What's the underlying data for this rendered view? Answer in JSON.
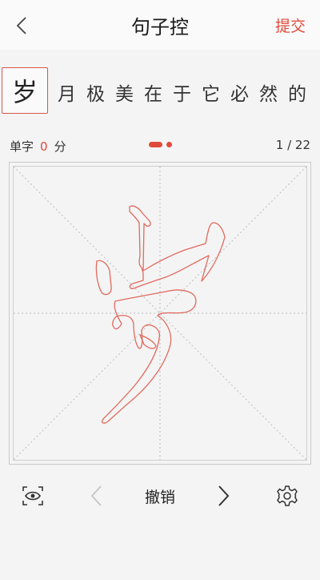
{
  "header": {
    "title": "句子控",
    "submit_label": "提交",
    "back_icon": "chevron-left-icon"
  },
  "sentence": {
    "current_char": "岁",
    "upcoming_chars": [
      "月",
      "极",
      "美",
      "在",
      "于",
      "它",
      "必",
      "然",
      "的"
    ]
  },
  "status": {
    "score_label": "单字",
    "score_value": "0",
    "score_unit": "分",
    "page_counter": "1 / 22"
  },
  "canvas": {
    "trace_char": "岁",
    "guide_color": "#bdbdbd",
    "trace_color": "#e06a5e"
  },
  "toolbar": {
    "preview_icon": "eye-icon",
    "prev_icon": "chevron-left-icon",
    "undo_label": "撤销",
    "next_icon": "chevron-right-icon",
    "settings_icon": "gear-icon"
  },
  "colors": {
    "accent": "#e04a3a",
    "background": "#f4f4f4"
  }
}
